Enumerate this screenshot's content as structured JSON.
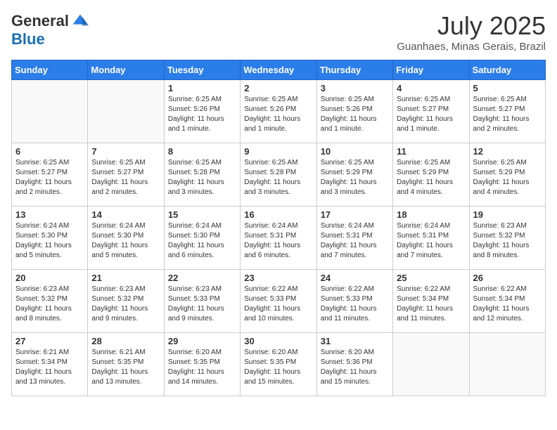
{
  "header": {
    "logo_line1": "General",
    "logo_line2": "Blue",
    "month_title": "July 2025",
    "location": "Guanhaes, Minas Gerais, Brazil"
  },
  "weekdays": [
    "Sunday",
    "Monday",
    "Tuesday",
    "Wednesday",
    "Thursday",
    "Friday",
    "Saturday"
  ],
  "weeks": [
    [
      {
        "day": "",
        "info": ""
      },
      {
        "day": "",
        "info": ""
      },
      {
        "day": "1",
        "info": "Sunrise: 6:25 AM\nSunset: 5:26 PM\nDaylight: 11 hours and 1 minute."
      },
      {
        "day": "2",
        "info": "Sunrise: 6:25 AM\nSunset: 5:26 PM\nDaylight: 11 hours and 1 minute."
      },
      {
        "day": "3",
        "info": "Sunrise: 6:25 AM\nSunset: 5:26 PM\nDaylight: 11 hours and 1 minute."
      },
      {
        "day": "4",
        "info": "Sunrise: 6:25 AM\nSunset: 5:27 PM\nDaylight: 11 hours and 1 minute."
      },
      {
        "day": "5",
        "info": "Sunrise: 6:25 AM\nSunset: 5:27 PM\nDaylight: 11 hours and 2 minutes."
      }
    ],
    [
      {
        "day": "6",
        "info": "Sunrise: 6:25 AM\nSunset: 5:27 PM\nDaylight: 11 hours and 2 minutes."
      },
      {
        "day": "7",
        "info": "Sunrise: 6:25 AM\nSunset: 5:27 PM\nDaylight: 11 hours and 2 minutes."
      },
      {
        "day": "8",
        "info": "Sunrise: 6:25 AM\nSunset: 5:28 PM\nDaylight: 11 hours and 3 minutes."
      },
      {
        "day": "9",
        "info": "Sunrise: 6:25 AM\nSunset: 5:28 PM\nDaylight: 11 hours and 3 minutes."
      },
      {
        "day": "10",
        "info": "Sunrise: 6:25 AM\nSunset: 5:29 PM\nDaylight: 11 hours and 3 minutes."
      },
      {
        "day": "11",
        "info": "Sunrise: 6:25 AM\nSunset: 5:29 PM\nDaylight: 11 hours and 4 minutes."
      },
      {
        "day": "12",
        "info": "Sunrise: 6:25 AM\nSunset: 5:29 PM\nDaylight: 11 hours and 4 minutes."
      }
    ],
    [
      {
        "day": "13",
        "info": "Sunrise: 6:24 AM\nSunset: 5:30 PM\nDaylight: 11 hours and 5 minutes."
      },
      {
        "day": "14",
        "info": "Sunrise: 6:24 AM\nSunset: 5:30 PM\nDaylight: 11 hours and 5 minutes."
      },
      {
        "day": "15",
        "info": "Sunrise: 6:24 AM\nSunset: 5:30 PM\nDaylight: 11 hours and 6 minutes."
      },
      {
        "day": "16",
        "info": "Sunrise: 6:24 AM\nSunset: 5:31 PM\nDaylight: 11 hours and 6 minutes."
      },
      {
        "day": "17",
        "info": "Sunrise: 6:24 AM\nSunset: 5:31 PM\nDaylight: 11 hours and 7 minutes."
      },
      {
        "day": "18",
        "info": "Sunrise: 6:24 AM\nSunset: 5:31 PM\nDaylight: 11 hours and 7 minutes."
      },
      {
        "day": "19",
        "info": "Sunrise: 6:23 AM\nSunset: 5:32 PM\nDaylight: 11 hours and 8 minutes."
      }
    ],
    [
      {
        "day": "20",
        "info": "Sunrise: 6:23 AM\nSunset: 5:32 PM\nDaylight: 11 hours and 8 minutes."
      },
      {
        "day": "21",
        "info": "Sunrise: 6:23 AM\nSunset: 5:32 PM\nDaylight: 11 hours and 9 minutes."
      },
      {
        "day": "22",
        "info": "Sunrise: 6:23 AM\nSunset: 5:33 PM\nDaylight: 11 hours and 9 minutes."
      },
      {
        "day": "23",
        "info": "Sunrise: 6:22 AM\nSunset: 5:33 PM\nDaylight: 11 hours and 10 minutes."
      },
      {
        "day": "24",
        "info": "Sunrise: 6:22 AM\nSunset: 5:33 PM\nDaylight: 11 hours and 11 minutes."
      },
      {
        "day": "25",
        "info": "Sunrise: 6:22 AM\nSunset: 5:34 PM\nDaylight: 11 hours and 11 minutes."
      },
      {
        "day": "26",
        "info": "Sunrise: 6:22 AM\nSunset: 5:34 PM\nDaylight: 11 hours and 12 minutes."
      }
    ],
    [
      {
        "day": "27",
        "info": "Sunrise: 6:21 AM\nSunset: 5:34 PM\nDaylight: 11 hours and 13 minutes."
      },
      {
        "day": "28",
        "info": "Sunrise: 6:21 AM\nSunset: 5:35 PM\nDaylight: 11 hours and 13 minutes."
      },
      {
        "day": "29",
        "info": "Sunrise: 6:20 AM\nSunset: 5:35 PM\nDaylight: 11 hours and 14 minutes."
      },
      {
        "day": "30",
        "info": "Sunrise: 6:20 AM\nSunset: 5:35 PM\nDaylight: 11 hours and 15 minutes."
      },
      {
        "day": "31",
        "info": "Sunrise: 6:20 AM\nSunset: 5:36 PM\nDaylight: 11 hours and 15 minutes."
      },
      {
        "day": "",
        "info": ""
      },
      {
        "day": "",
        "info": ""
      }
    ]
  ]
}
